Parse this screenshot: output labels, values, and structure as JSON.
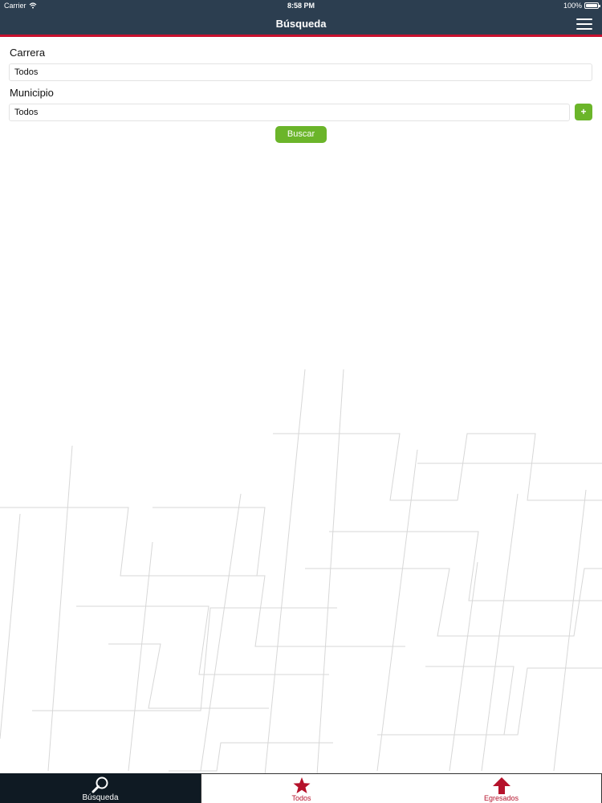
{
  "status_bar": {
    "carrier": "Carrier",
    "time": "8:58 PM",
    "battery": "100%"
  },
  "nav": {
    "title": "Búsqueda"
  },
  "form": {
    "carrera_label": "Carrera",
    "carrera_value": "Todos",
    "municipio_label": "Municipio",
    "municipio_value": "Todos",
    "add_label": "+",
    "search_label": "Buscar"
  },
  "tabs": [
    {
      "label": "Búsqueda",
      "icon": "search-icon",
      "selected": true
    },
    {
      "label": "Todos",
      "icon": "star-icon",
      "selected": false
    },
    {
      "label": "Egresados",
      "icon": "arrow-up-icon",
      "selected": false
    }
  ],
  "colors": {
    "nav_bg": "#2c3e50",
    "accent_red": "#c8102e",
    "button_green": "#6bb52a",
    "tab_active_bg": "#0f1a23"
  }
}
